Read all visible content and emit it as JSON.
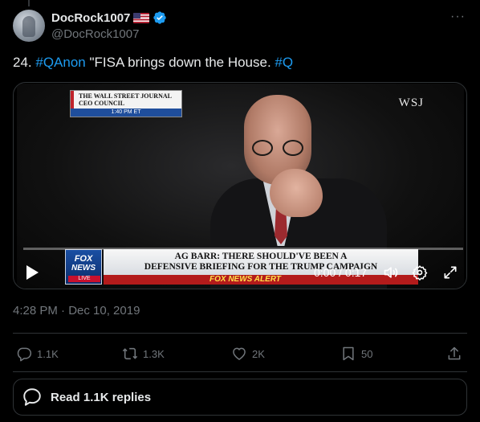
{
  "author": {
    "display_name": "DocRock1007",
    "handle": "@DocRock1007",
    "flag_icon": "us-flag-icon",
    "verified_icon": "verified-badge-icon"
  },
  "more_label": "···",
  "tweet": {
    "prefix": "24. ",
    "hashtag1": "#QAnon",
    "middle": " \"FISA brings down the House. ",
    "hashtag2": "#Q"
  },
  "video": {
    "wsj_box_line1": "THE WALL STREET JOURNAL",
    "wsj_box_line2": "CEO COUNCIL",
    "wsj_box_time": "1:40 PM ET",
    "wsj_watermark": "WSJ",
    "fox_logo_line1": "FOX",
    "fox_logo_line2": "NEWS",
    "fox_logo_line3": "LIVE",
    "headline_line1": "AG BARR: THERE SHOULD'VE BEEN A",
    "headline_line2": "DEFENSIVE BRIEFING FOR THE TRUMP CAMPAIGN",
    "ticker_text": "FOX NEWS ALERT",
    "time_readout": "0:00 / 0:17",
    "progress_fraction": 0.0
  },
  "timestamp": "4:28 PM · Dec 10, 2019",
  "actions": {
    "replies": "1.1K",
    "reposts": "1.3K",
    "likes": "2K",
    "bookmarks": "50"
  },
  "read_replies_label": "Read 1.1K replies",
  "colors": {
    "background": "#000000",
    "accent": "#1d9bf0",
    "muted": "#71767b",
    "border": "#2f3336"
  }
}
